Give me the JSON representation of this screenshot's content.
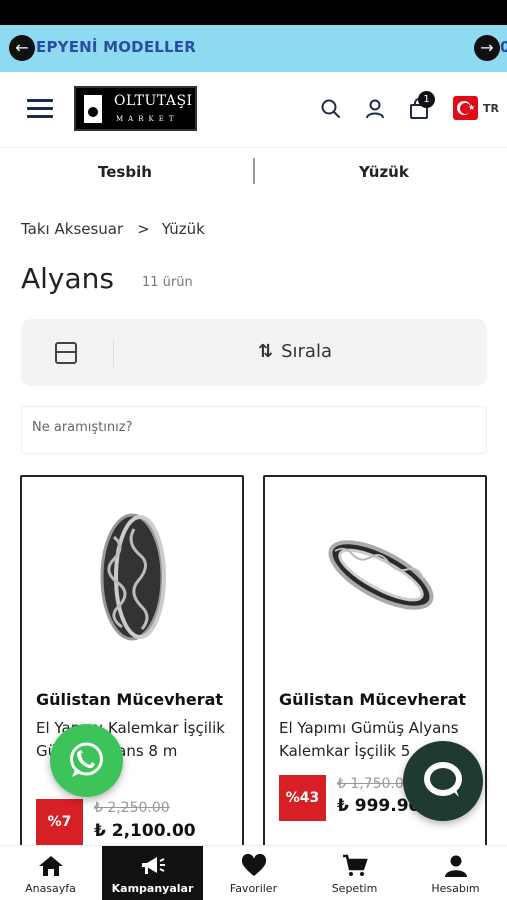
{
  "promo": {
    "text": "EPYENİ MODELLER",
    "text_next": "0"
  },
  "header": {
    "logo_name": "OLTUTAŞI",
    "logo_sub": "MARKET",
    "cart_count": "1",
    "language": "TR"
  },
  "categories": [
    "Tesbih",
    "Yüzük"
  ],
  "breadcrumb": {
    "items": [
      "Takı Aksesuar",
      "Yüzük"
    ],
    "separator": ">"
  },
  "page": {
    "title": "Alyans",
    "count": "11 ürün"
  },
  "toolbar": {
    "sort_label": "Sırala"
  },
  "search": {
    "placeholder": "Ne aramıştınız?"
  },
  "products": [
    {
      "brand": "Gülistan Mücevherat",
      "name": "El Yapımı Kalemkar İşçilik Gümüş Alyans 8 m",
      "discount": "%7",
      "old_price": "₺ 2,250.00",
      "new_price": "₺ 2,100.00"
    },
    {
      "brand": "Gülistan Mücevherat",
      "name": "El Yapımı Gümüş Alyans Kalemkar İşçilik 5",
      "discount": "%43",
      "old_price": "₺ 1,750.00",
      "new_price": "₺ 999.90"
    }
  ],
  "bottom_nav": [
    {
      "label": "Anasayfa",
      "icon": "home-icon"
    },
    {
      "label": "Kampanyalar",
      "icon": "megaphone-icon",
      "active": true
    },
    {
      "label": "Favoriler",
      "icon": "heart-icon"
    },
    {
      "label": "Sepetim",
      "icon": "cart-icon"
    },
    {
      "label": "Hesabım",
      "icon": "user-icon"
    }
  ],
  "colors": {
    "promo_bg": "#8edaf0",
    "discount": "#d71f26",
    "whatsapp": "#3cc45b",
    "nav_active": "#111111"
  }
}
